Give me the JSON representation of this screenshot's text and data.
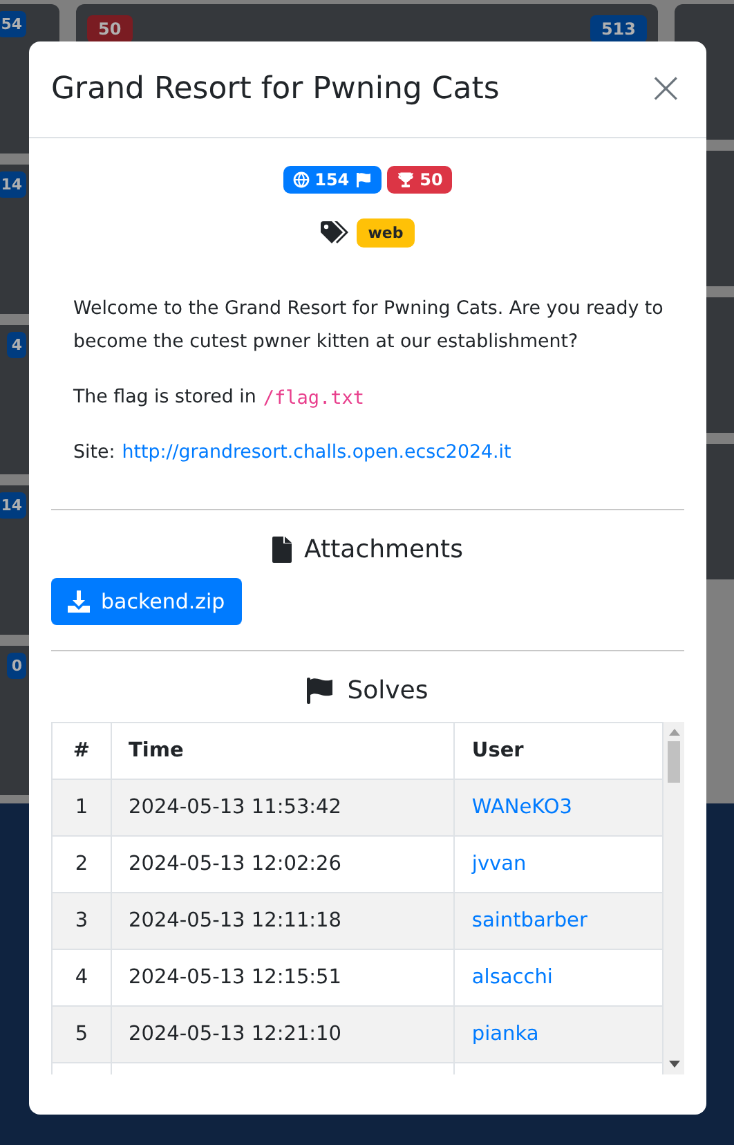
{
  "background": {
    "left_cards": [
      {
        "solves": "54"
      },
      {
        "solves": "14"
      },
      {
        "solves": "4"
      },
      {
        "solves": "14"
      },
      {
        "solves": "0"
      }
    ],
    "top_card": {
      "points": "50",
      "solves": "513"
    }
  },
  "modal": {
    "title": "Grand Resort for Pwning Cats",
    "close": "×",
    "solves_badge": "154",
    "points_badge": "50",
    "tags": [
      "web"
    ],
    "description": [
      "Welcome to the Grand Resort for Pwning Cats. Are you ready to become the cutest pwner kitten at our establishment?"
    ],
    "flag_text": "The flag is stored in",
    "flag_path": "/flag.txt",
    "site_label": "Site:",
    "site_url": "http://grandresort.challs.open.ecsc2024.it",
    "attachments_heading": "Attachments",
    "attachments": [
      "backend.zip"
    ],
    "solves_heading": "Solves",
    "table": {
      "columns": [
        "#",
        "Time",
        "User"
      ],
      "rows": [
        {
          "n": "1",
          "time": "2024-05-13 11:53:42",
          "user": "WANeKO3"
        },
        {
          "n": "2",
          "time": "2024-05-13 12:02:26",
          "user": "jvvan"
        },
        {
          "n": "3",
          "time": "2024-05-13 12:11:18",
          "user": "saintbarber"
        },
        {
          "n": "4",
          "time": "2024-05-13 12:15:51",
          "user": "alsacchi"
        },
        {
          "n": "5",
          "time": "2024-05-13 12:21:10",
          "user": "pianka"
        }
      ]
    }
  }
}
